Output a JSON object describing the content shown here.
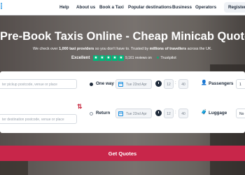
{
  "nav": {
    "items": [
      "Help",
      "About us",
      "Book a Taxi",
      "Popular destinations",
      "Business",
      "Operators"
    ],
    "register_label": "Register"
  },
  "hero": {
    "title": "Pre-Book Taxis Online - Cheap Minicab Quotes",
    "subtitle_pre": "We check over ",
    "subtitle_count": "1,000 taxi providers",
    "subtitle_mid": " so you don't have to. Trusted by ",
    "subtitle_users": "millions of travellers",
    "subtitle_post": " across the UK."
  },
  "rating": {
    "label": "Excellent",
    "stars": 5,
    "reviews": "9,161 reviews on",
    "trustpilot": "Trustpilot",
    "star_color": "#00b67a"
  },
  "form": {
    "pickup_placeholder": "ter pickup postcode, venue or place",
    "destination_placeholder": "ter destination postcode, venue or place",
    "one_way_label": "One way",
    "return_label": "Return",
    "date_one_way": "Tue 22nd Apr",
    "date_return": "Tue 22nd Apr",
    "hour_one_way": "12",
    "minute_one_way": "40",
    "hour_return": "12",
    "minute_return": "40",
    "passengers_label": "Passengers",
    "passengers_value": "1",
    "luggage_label": "Luggage",
    "luggage_value": "No"
  },
  "cta": {
    "label": "Get Quotes",
    "color": "#c8264a"
  }
}
